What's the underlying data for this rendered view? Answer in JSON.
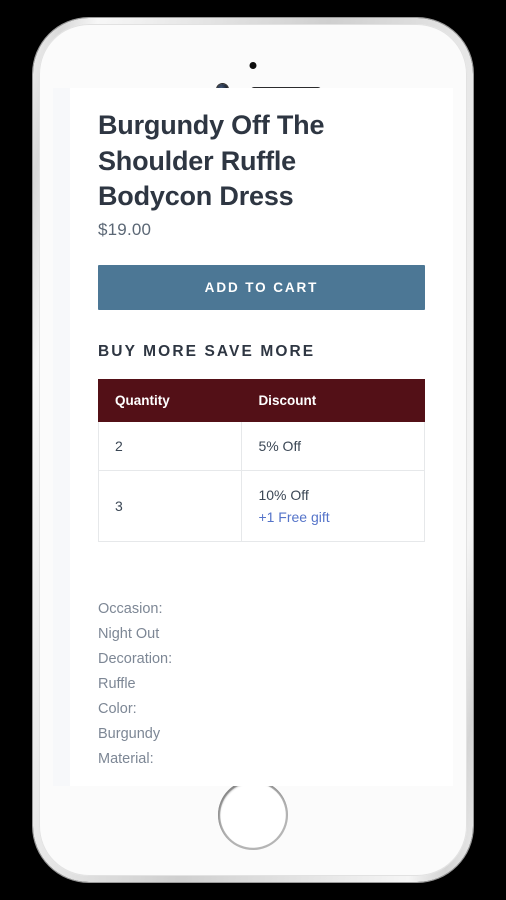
{
  "device": {
    "type": "smartphone-mockup",
    "icons": {
      "camera": "camera-lens-icon",
      "sensor": "proximity-sensor-icon",
      "speaker": "earpiece-speaker-icon",
      "home": "home-button-icon"
    }
  },
  "product": {
    "title": "Burgundy Off The Shoulder Ruffle Bodycon Dress",
    "price": "$19.00"
  },
  "actions": {
    "add_to_cart_label": "ADD TO CART"
  },
  "promo": {
    "heading": "BUY MORE SAVE MORE",
    "table": {
      "columns": [
        "Quantity",
        "Discount"
      ],
      "rows": [
        {
          "quantity": "2",
          "discount": "5% Off",
          "gift": ""
        },
        {
          "quantity": "3",
          "discount": "10% Off",
          "gift": "+1 Free gift"
        }
      ]
    }
  },
  "details": {
    "lines": [
      "Occasion:",
      "Night Out",
      "Decoration:",
      "Ruffle",
      "Color:",
      "Burgundy",
      "Material:"
    ]
  },
  "colors": {
    "accent_button": "#4c7795",
    "table_header": "#531017",
    "link": "#5574c9",
    "title_text": "#2e3642",
    "body_text": "#7d8795"
  }
}
